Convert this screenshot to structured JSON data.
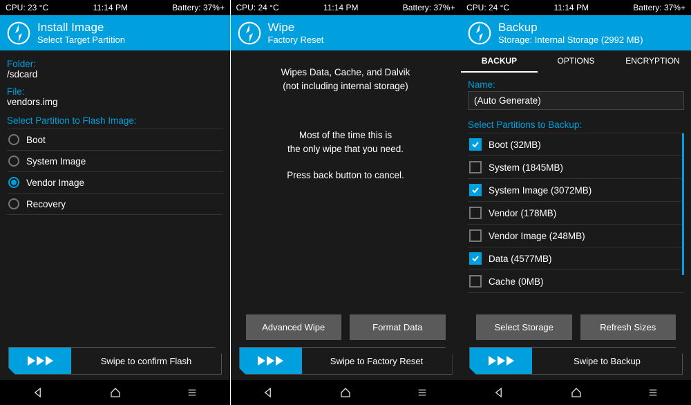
{
  "screens": [
    {
      "status": {
        "cpu": "CPU: 23 °C",
        "time": "11:14 PM",
        "battery": "Battery: 37%+"
      },
      "header": {
        "title": "Install Image",
        "subtitle": "Select Target Partition"
      },
      "folder_label": "Folder:",
      "folder_value": "/sdcard",
      "file_label": "File:",
      "file_value": "vendors.img",
      "partition_label": "Select Partition to Flash Image:",
      "partitions": [
        "Boot",
        "System Image",
        "Vendor Image",
        "Recovery"
      ],
      "selected_partition": 2,
      "slider_label": "Swipe to confirm Flash"
    },
    {
      "status": {
        "cpu": "CPU: 24 °C",
        "time": "11:14 PM",
        "battery": "Battery: 37%+"
      },
      "header": {
        "title": "Wipe",
        "subtitle": "Factory Reset"
      },
      "wipe_info_1": "Wipes Data, Cache, and Dalvik",
      "wipe_info_2": "(not including internal storage)",
      "wipe_msg_1": "Most of the time this is",
      "wipe_msg_2": "the only wipe that you need.",
      "wipe_msg_3": "Press back button to cancel.",
      "btn_advanced": "Advanced Wipe",
      "btn_format": "Format Data",
      "slider_label": "Swipe to Factory Reset"
    },
    {
      "status": {
        "cpu": "CPU: 24 °C",
        "time": "11:14 PM",
        "battery": "Battery: 37%+"
      },
      "header": {
        "title": "Backup",
        "subtitle": "Storage: Internal Storage (2992 MB)"
      },
      "tabs": [
        "BACKUP",
        "OPTIONS",
        "ENCRYPTION"
      ],
      "active_tab": 0,
      "name_label": "Name:",
      "name_value": "(Auto Generate)",
      "partition_label": "Select Partitions to Backup:",
      "partitions": [
        {
          "label": "Boot (32MB)",
          "checked": true
        },
        {
          "label": "System (1845MB)",
          "checked": false
        },
        {
          "label": "System Image (3072MB)",
          "checked": true
        },
        {
          "label": "Vendor (178MB)",
          "checked": false
        },
        {
          "label": "Vendor Image (248MB)",
          "checked": false
        },
        {
          "label": "Data (4577MB)",
          "checked": true
        },
        {
          "label": "Cache (0MB)",
          "checked": false
        }
      ],
      "btn_storage": "Select Storage",
      "btn_refresh": "Refresh Sizes",
      "slider_label": "Swipe to Backup"
    }
  ]
}
